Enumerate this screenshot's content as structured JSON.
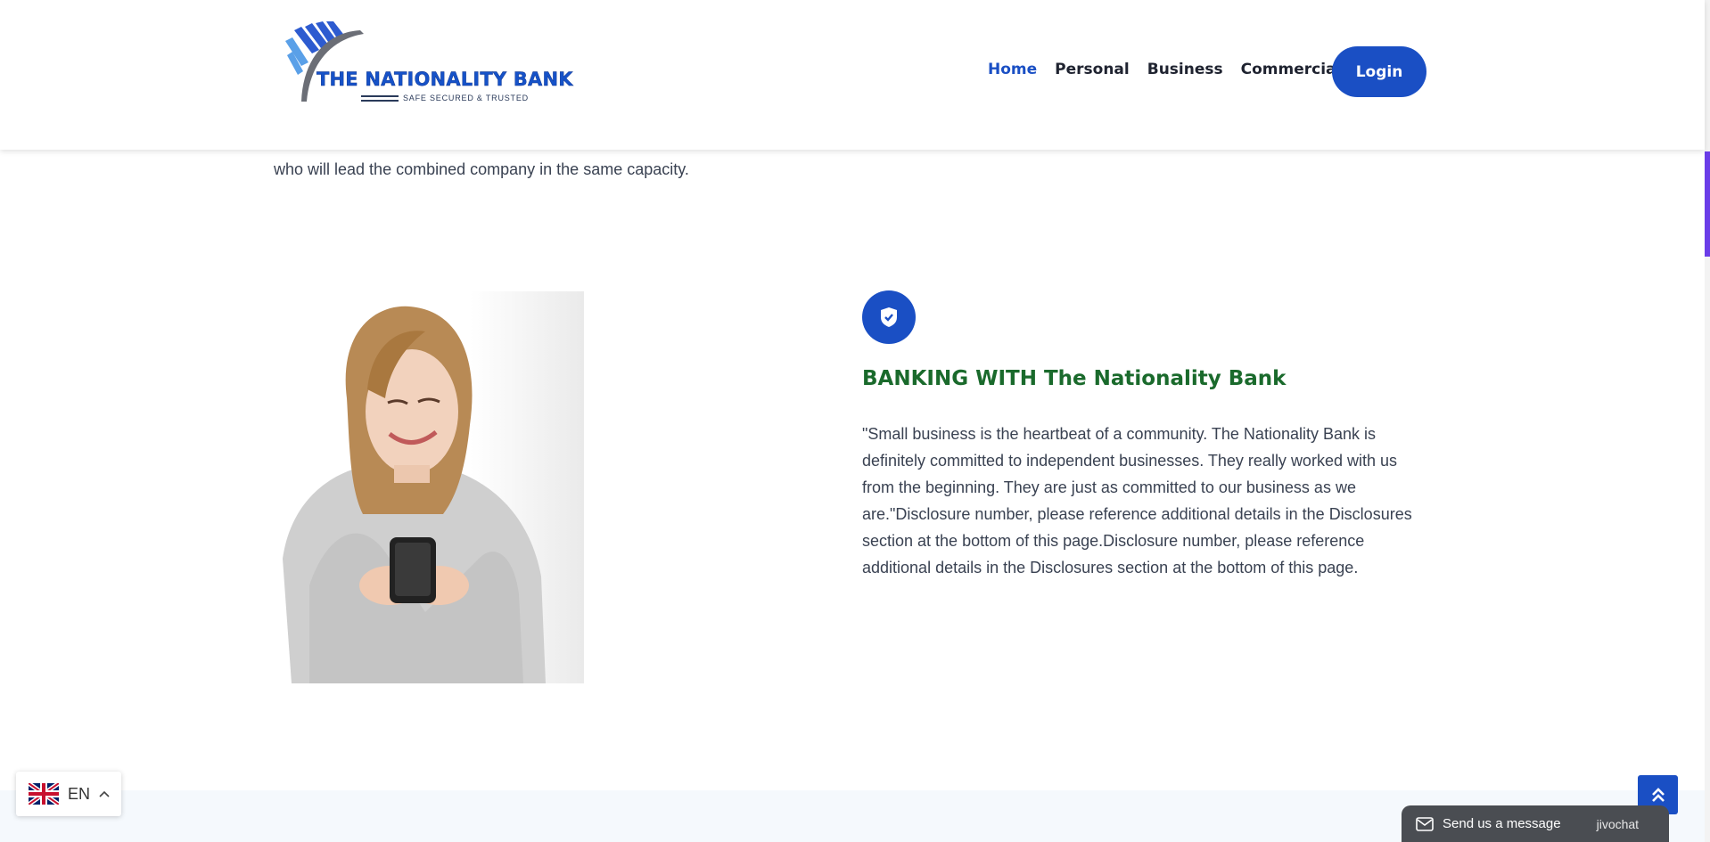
{
  "header": {
    "brand_name": "THE NATIONALITY BANK",
    "brand_tagline": "SAFE SECURED & TRUSTED",
    "nav": [
      {
        "label": "Home",
        "active": true
      },
      {
        "label": "Personal",
        "active": false
      },
      {
        "label": "Business",
        "active": false
      },
      {
        "label": "Commercial",
        "active": false
      }
    ],
    "login_label": "Login"
  },
  "intro": {
    "text": "who will lead the combined company in the same capacity."
  },
  "feature": {
    "icon": "shield-check-icon",
    "title": "BANKING WITH The Nationality Bank",
    "body": "\"Small business is the heartbeat of a community. The Nationality Bank is definitely committed to independent businesses. They really worked with us from the beginning. They are just as committed to our business as we are.\"Disclosure number, please reference additional details in the Disclosures section at the bottom of this page.Disclosure number, please reference additional details in the Disclosures section at the bottom of this page."
  },
  "language": {
    "code": "EN",
    "flag": "uk-flag-icon"
  },
  "chat": {
    "label": "Send us a message",
    "brand": "jivochat"
  },
  "colors": {
    "accent": "#1a4fc4",
    "title_green": "#1a6a2c",
    "scroll_accent": "#6a3de8"
  }
}
